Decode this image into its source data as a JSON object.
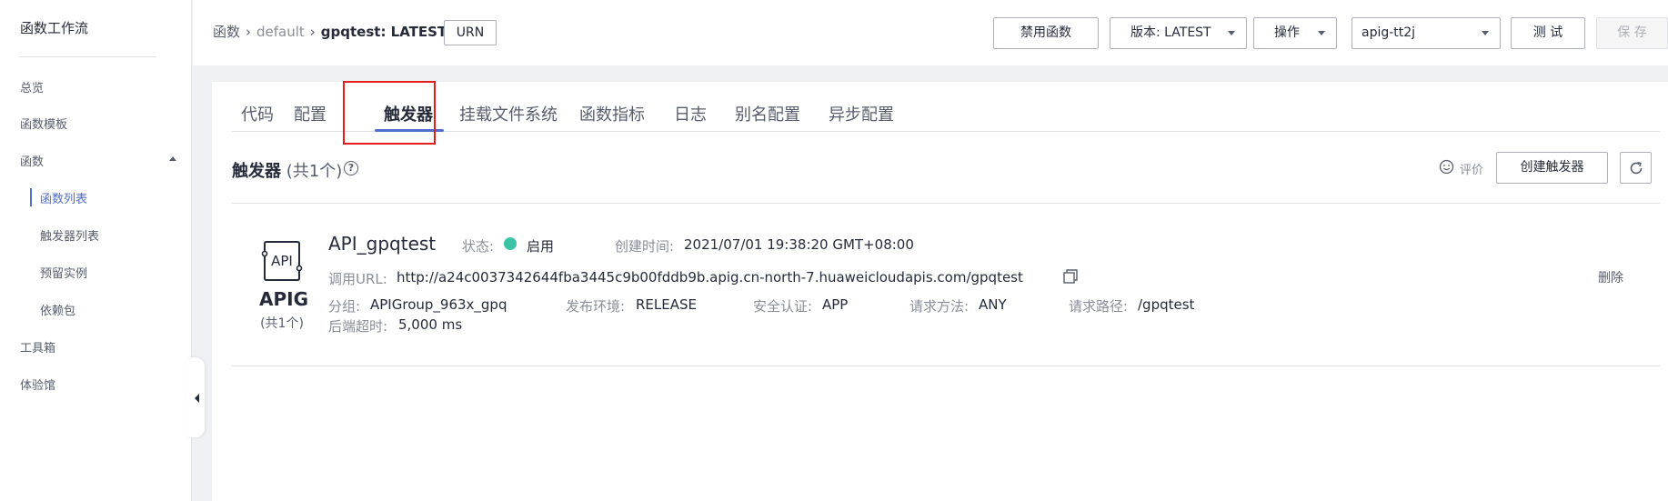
{
  "sidebar": {
    "title": "函数工作流",
    "items": [
      {
        "label": "总览"
      },
      {
        "label": "函数模板"
      },
      {
        "label": "函数"
      },
      {
        "label": "函数列表"
      },
      {
        "label": "触发器列表"
      },
      {
        "label": "预留实例"
      },
      {
        "label": "依赖包"
      },
      {
        "label": "工具箱"
      },
      {
        "label": "体验馆"
      }
    ]
  },
  "header": {
    "breadcrumb": {
      "root": "函数",
      "mid": "default",
      "current": "gpqtest: LATEST"
    },
    "urn_label": "URN",
    "disable_label": "禁用函数",
    "version_label": "版本: LATEST",
    "ops_label": "操作",
    "select_value": "apig-tt2j",
    "test_label": "测 试",
    "save_label": "保 存"
  },
  "tabs": [
    {
      "label": "代码"
    },
    {
      "label": "配置"
    },
    {
      "label": "触发器"
    },
    {
      "label": "挂载文件系统"
    },
    {
      "label": "函数指标"
    },
    {
      "label": "日志"
    },
    {
      "label": "别名配置"
    },
    {
      "label": "异步配置"
    }
  ],
  "section": {
    "title": "触发器",
    "count": "(共1个)",
    "help": "?",
    "rate_label": "评价",
    "create_label": "创建触发器"
  },
  "trigger": {
    "logo_text": "API",
    "type": "APIG",
    "type_count": "(共1个)",
    "name": "API_gpqtest",
    "status_label": "状态:",
    "status_value": "启用",
    "created_label": "创建时间:",
    "created_value": "2021/07/01 19:38:20 GMT+08:00",
    "url_label": "调用URL:",
    "url_value": "http://a24c0037342644fba3445c9b00fddb9b.apig.cn-north-7.huaweicloudapis.com/gpqtest",
    "group_label": "分组:",
    "group_value": "APIGroup_963x_gpq",
    "env_label": "发布环境:",
    "env_value": "RELEASE",
    "auth_label": "安全认证:",
    "auth_value": "APP",
    "method_label": "请求方法:",
    "method_value": "ANY",
    "path_label": "请求路径:",
    "path_value": "/gpqtest",
    "timeout_label": "后端超时:",
    "timeout_value": "5,000 ms",
    "delete_label": "删除"
  },
  "colors": {
    "accent": "#526ecc",
    "status_green": "#3ac3a5",
    "highlight": "#e41e1e"
  }
}
